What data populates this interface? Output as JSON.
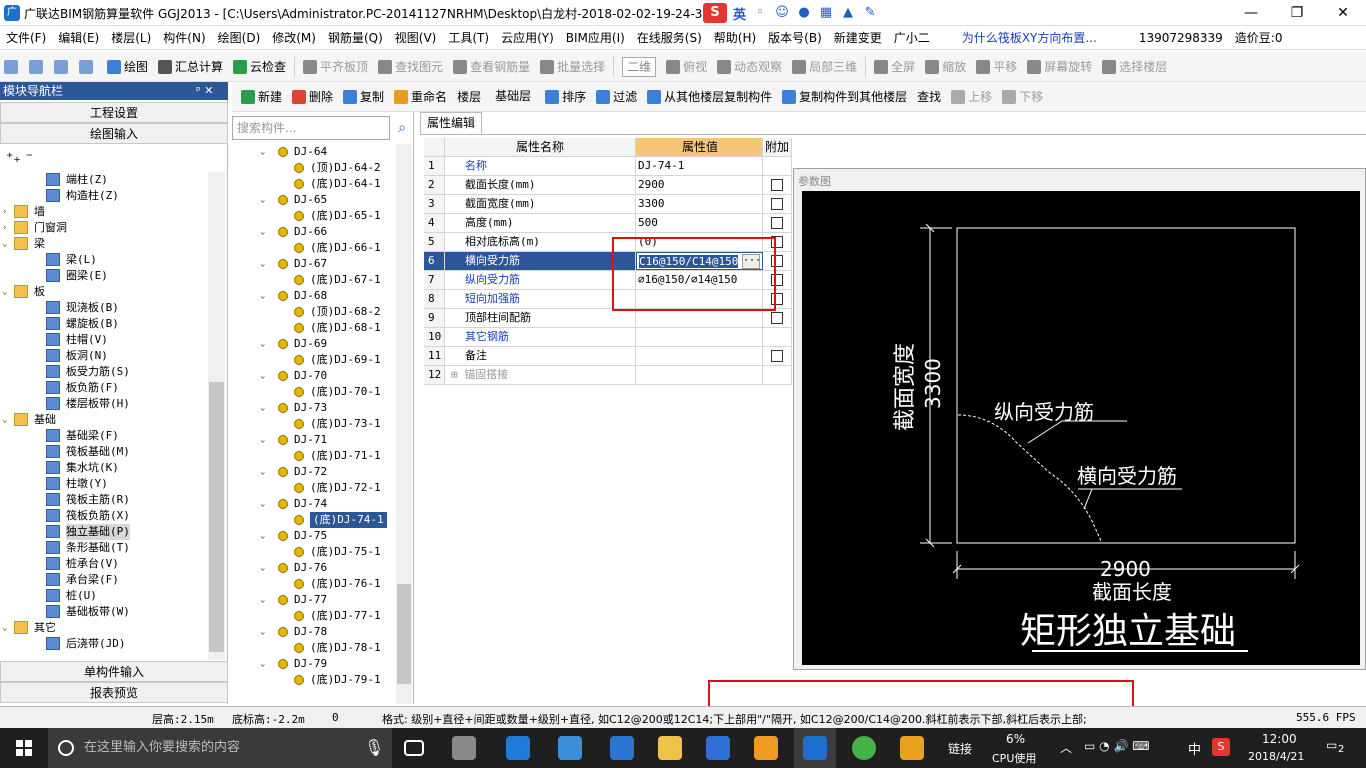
{
  "window": {
    "title": "广联达BIM钢筋算量软件 GGJ2013 - [C:\\Users\\Administrator.PC-20141127NRHM\\Desktop\\白龙村-2018-02-02-19-24-35",
    "ime": {
      "s": "S",
      "lang": "英"
    }
  },
  "menu": [
    "文件(F)",
    "编辑(E)",
    "楼层(L)",
    "构件(N)",
    "绘图(D)",
    "修改(M)",
    "钢筋量(Q)",
    "视图(V)",
    "工具(T)",
    "云应用(Y)",
    "BIM应用(I)",
    "在线服务(S)",
    "帮助(H)",
    "版本号(B)",
    "新建变更",
    "广小二",
    "为什么筏板XY方向布置...",
    "13907298339",
    "造价豆:0"
  ],
  "toolbar1": [
    "绘图",
    "汇总计算",
    "云检查",
    "平齐板顶",
    "查找图元",
    "查看钢筋量",
    "批量选择",
    "二维",
    "俯视",
    "动态观察",
    "局部三维",
    "全屏",
    "缩放",
    "平移",
    "屏幕旋转",
    "选择楼层"
  ],
  "toolbar2": [
    "新建",
    "删除",
    "复制",
    "重命名",
    "楼层",
    "基础层",
    "排序",
    "过滤",
    "从其他楼层复制构件",
    "复制构件到其他楼层",
    "查找",
    "上移",
    "下移"
  ],
  "nav": {
    "title": "模块导航栏",
    "buttons": [
      "工程设置",
      "绘图输入"
    ],
    "bottom_buttons": [
      "单构件输入",
      "报表预览"
    ],
    "tree": [
      {
        "t": "c",
        "l": "端柱(Z)",
        "lv": 2
      },
      {
        "t": "c",
        "l": "构造柱(Z)",
        "lv": 2
      },
      {
        "t": "f",
        "l": "墙",
        "lv": 1,
        "tg": "›"
      },
      {
        "t": "f",
        "l": "门窗洞",
        "lv": 1,
        "tg": "›"
      },
      {
        "t": "f",
        "l": "梁",
        "lv": 1,
        "tg": "⌄"
      },
      {
        "t": "c",
        "l": "梁(L)",
        "lv": 2
      },
      {
        "t": "c",
        "l": "圈梁(E)",
        "lv": 2
      },
      {
        "t": "f",
        "l": "板",
        "lv": 1,
        "tg": "⌄"
      },
      {
        "t": "c",
        "l": "现浇板(B)",
        "lv": 2
      },
      {
        "t": "c",
        "l": "螺旋板(B)",
        "lv": 2
      },
      {
        "t": "c",
        "l": "柱帽(V)",
        "lv": 2
      },
      {
        "t": "c",
        "l": "板洞(N)",
        "lv": 2
      },
      {
        "t": "c",
        "l": "板受力筋(S)",
        "lv": 2
      },
      {
        "t": "c",
        "l": "板负筋(F)",
        "lv": 2
      },
      {
        "t": "c",
        "l": "楼层板带(H)",
        "lv": 2
      },
      {
        "t": "f",
        "l": "基础",
        "lv": 1,
        "tg": "⌄"
      },
      {
        "t": "c",
        "l": "基础梁(F)",
        "lv": 2
      },
      {
        "t": "c",
        "l": "筏板基础(M)",
        "lv": 2
      },
      {
        "t": "c",
        "l": "集水坑(K)",
        "lv": 2
      },
      {
        "t": "c",
        "l": "柱墩(Y)",
        "lv": 2
      },
      {
        "t": "c",
        "l": "筏板主筋(R)",
        "lv": 2
      },
      {
        "t": "c",
        "l": "筏板负筋(X)",
        "lv": 2
      },
      {
        "t": "c",
        "l": "独立基础(P)",
        "lv": 2,
        "sel": true
      },
      {
        "t": "c",
        "l": "条形基础(T)",
        "lv": 2
      },
      {
        "t": "c",
        "l": "桩承台(V)",
        "lv": 2
      },
      {
        "t": "c",
        "l": "承台梁(F)",
        "lv": 2
      },
      {
        "t": "c",
        "l": "桩(U)",
        "lv": 2
      },
      {
        "t": "c",
        "l": "基础板带(W)",
        "lv": 2
      },
      {
        "t": "f",
        "l": "其它",
        "lv": 1,
        "tg": "⌄"
      },
      {
        "t": "c",
        "l": "后浇带(JD)",
        "lv": 2
      }
    ]
  },
  "search": {
    "placeholder": "搜索构件..."
  },
  "list": [
    {
      "l": "DJ-64",
      "lv": 1
    },
    {
      "l": "(顶)DJ-64-2",
      "lv": 2
    },
    {
      "l": "(底)DJ-64-1",
      "lv": 2
    },
    {
      "l": "DJ-65",
      "lv": 1
    },
    {
      "l": "(底)DJ-65-1",
      "lv": 2
    },
    {
      "l": "DJ-66",
      "lv": 1
    },
    {
      "l": "(底)DJ-66-1",
      "lv": 2
    },
    {
      "l": "DJ-67",
      "lv": 1
    },
    {
      "l": "(底)DJ-67-1",
      "lv": 2
    },
    {
      "l": "DJ-68",
      "lv": 1
    },
    {
      "l": "(顶)DJ-68-2",
      "lv": 2
    },
    {
      "l": "(底)DJ-68-1",
      "lv": 2
    },
    {
      "l": "DJ-69",
      "lv": 1
    },
    {
      "l": "(底)DJ-69-1",
      "lv": 2
    },
    {
      "l": "DJ-70",
      "lv": 1
    },
    {
      "l": "(底)DJ-70-1",
      "lv": 2
    },
    {
      "l": "DJ-73",
      "lv": 1
    },
    {
      "l": "(底)DJ-73-1",
      "lv": 2
    },
    {
      "l": "DJ-71",
      "lv": 1
    },
    {
      "l": "(底)DJ-71-1",
      "lv": 2
    },
    {
      "l": "DJ-72",
      "lv": 1
    },
    {
      "l": "(底)DJ-72-1",
      "lv": 2
    },
    {
      "l": "DJ-74",
      "lv": 1
    },
    {
      "l": "(底)DJ-74-1",
      "lv": 2,
      "sel": true
    },
    {
      "l": "DJ-75",
      "lv": 1
    },
    {
      "l": "(底)DJ-75-1",
      "lv": 2
    },
    {
      "l": "DJ-76",
      "lv": 1
    },
    {
      "l": "(底)DJ-76-1",
      "lv": 2
    },
    {
      "l": "DJ-77",
      "lv": 1
    },
    {
      "l": "(底)DJ-77-1",
      "lv": 2
    },
    {
      "l": "DJ-78",
      "lv": 1
    },
    {
      "l": "(底)DJ-78-1",
      "lv": 2
    },
    {
      "l": "DJ-79",
      "lv": 1
    },
    {
      "l": "(底)DJ-79-1",
      "lv": 2
    }
  ],
  "props": {
    "tab": "属性编辑",
    "headers": [
      "属性名称",
      "属性值",
      "附加"
    ],
    "rows": [
      {
        "no": "1",
        "name": "名称",
        "value": "DJ-74-1",
        "blue": true,
        "chk": false
      },
      {
        "no": "2",
        "name": "截面长度(mm)",
        "value": "2900",
        "chk": true
      },
      {
        "no": "3",
        "name": "截面宽度(mm)",
        "value": "3300",
        "chk": true
      },
      {
        "no": "4",
        "name": "高度(mm)",
        "value": "500",
        "chk": true
      },
      {
        "no": "5",
        "name": "相对底标高(m)",
        "value": "(0)",
        "chk": true
      },
      {
        "no": "6",
        "name": "横向受力筋",
        "value": "C16@150/C14@150",
        "blue": true,
        "hl": true,
        "chk": true
      },
      {
        "no": "7",
        "name": "纵向受力筋",
        "value": "⌀16@150/⌀14@150",
        "blue": true,
        "chk": true
      },
      {
        "no": "8",
        "name": "短向加强筋",
        "value": "",
        "blue": true,
        "chk": true
      },
      {
        "no": "9",
        "name": "顶部柱间配筋",
        "value": "",
        "chk": true
      },
      {
        "no": "10",
        "name": "其它钢筋",
        "value": "",
        "blue": true,
        "chk": false
      },
      {
        "no": "11",
        "name": "备注",
        "value": "",
        "chk": true
      },
      {
        "no": "12",
        "name": "锚固搭接",
        "value": "",
        "chk": false,
        "plus": true
      }
    ]
  },
  "param": {
    "title": "参数图",
    "width_label": "截面宽度",
    "width_value": "3300",
    "length_label": "截面长度",
    "length_value": "2900",
    "label_long": "纵向受力筋",
    "label_trans": "横向受力筋",
    "caption": "矩形独立基础"
  },
  "status": {
    "floor_h": "层高:2.15m",
    "base_el": "底标高:-2.2m",
    "zero": "0",
    "hint": "格式: 级别+直径+间距或数量+级别+直径, 如C12@200或12C14;下上部用\"/\"隔开, 如C12@200/C14@200.斜杠前表示下部,斜杠后表示上部;",
    "fps": "555.6 FPS"
  },
  "taskbar": {
    "search": "在这里输入你要搜索的内容",
    "net": "链接",
    "cpu_pct": "6%",
    "cpu_label": "CPU使用",
    "lang": "中",
    "time": "12:00",
    "date": "2018/4/21",
    "notif": "2"
  }
}
